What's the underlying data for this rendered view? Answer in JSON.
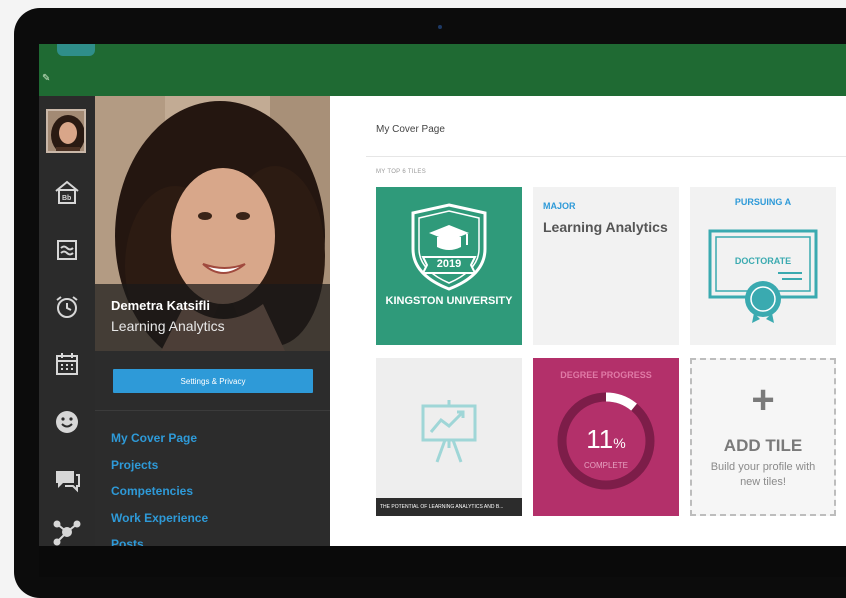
{
  "profile": {
    "name": "Demetra Katsifli",
    "program": "Learning Analytics",
    "settings_button": "Settings & Privacy",
    "nav": [
      "My Cover Page",
      "Projects",
      "Competencies",
      "Work Experience",
      "Posts"
    ]
  },
  "rail": {
    "icons": [
      "home-bb-icon",
      "courses-icon",
      "alarm-clock-icon",
      "calendar-icon",
      "smiley-icon",
      "chat-icon",
      "network-icon"
    ]
  },
  "main": {
    "page_title": "My Cover Page",
    "tiles_label": "MY TOP 6 TILES",
    "tiles": {
      "university": {
        "year": "2019",
        "name": "KINGSTON UNIVERSITY"
      },
      "major": {
        "label": "MAJOR",
        "value": "Learning Analytics"
      },
      "pursuing": {
        "label": "PURSUING A",
        "diploma": "DOCTORATE"
      },
      "project": {
        "caption": "THE POTENTIAL OF LEARNING ANALYTICS AND B..."
      },
      "progress": {
        "label": "DEGREE PROGRESS",
        "value": "11",
        "unit": "%",
        "status": "COMPLETE",
        "fraction": 0.11
      },
      "add": {
        "plus": "+",
        "title": "ADD TILE",
        "subtitle": "Build your profile with new tiles!"
      }
    }
  },
  "colors": {
    "topbar": "#1f6a33",
    "accent": "#2e9ad8",
    "university_tile": "#2f9a7a",
    "progress_tile": "#b3306a",
    "sidebar": "#2c2c2c"
  }
}
